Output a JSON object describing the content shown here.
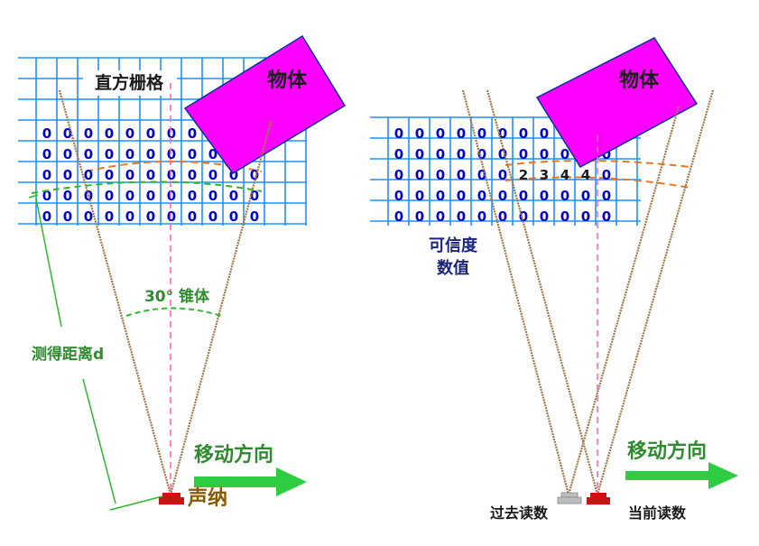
{
  "colors": {
    "grid": "#1e90ff",
    "zero": "#0000cd",
    "object": "#ff00ff",
    "cone_line": "#a0784a",
    "center_line": "#ff69b4",
    "arc": "#2eb82e",
    "arc_orange": "#e87722",
    "label_green": "#2e8b2e",
    "label_navy": "#1a237e",
    "arrow": "#2ecc40",
    "sonar_red": "#cc1111",
    "sonar_gray": "#bdbdbd",
    "sonar_label": "#8b5a00"
  },
  "left_panel": {
    "grid_title": "直方栅格",
    "object_label": "物体",
    "cone_label": "30° 锥体",
    "distance_label": "测得距离d",
    "direction_label": "移动方向",
    "sonar_label": "声纳",
    "rows": [
      [
        "0",
        "0",
        "0",
        "0",
        "0",
        "0",
        "0",
        "0",
        "0",
        "0",
        "0"
      ],
      [
        "0",
        "0",
        "0",
        "0",
        "0",
        "0",
        "0",
        "0",
        "0",
        "0",
        "0"
      ],
      [
        "0",
        "0",
        "0",
        "0",
        "0",
        "0",
        "0",
        "0",
        "0",
        "0",
        "0"
      ],
      [
        "0",
        "0",
        "0",
        "0",
        "0",
        "0",
        "0",
        "0",
        "0",
        "0",
        "0"
      ],
      [
        "0",
        "0",
        "0",
        "0",
        "0",
        "0",
        "0",
        "0",
        "0",
        "0",
        "0"
      ]
    ]
  },
  "right_panel": {
    "object_label": "物体",
    "confidence_label_line1": "可信度",
    "confidence_label_line2": "数值",
    "direction_label": "移动方向",
    "past_reading_label": "过去读数",
    "current_reading_label": "当前读数",
    "rows": [
      [
        "0",
        "0",
        "0",
        "0",
        "0",
        "0",
        "0",
        "0",
        "0",
        "0",
        "0"
      ],
      [
        "0",
        "0",
        "0",
        "0",
        "0",
        "0",
        "0",
        "0",
        "0",
        "0",
        "0"
      ],
      [
        "0",
        "0",
        "0",
        "0",
        "0",
        "0",
        "2",
        "3",
        "4",
        "4",
        "0"
      ],
      [
        "0",
        "0",
        "0",
        "0",
        "0",
        "0",
        "0",
        "0",
        "0",
        "0",
        "0"
      ],
      [
        "0",
        "0",
        "0",
        "0",
        "0",
        "0",
        "0",
        "0",
        "0",
        "0",
        "0"
      ]
    ]
  }
}
